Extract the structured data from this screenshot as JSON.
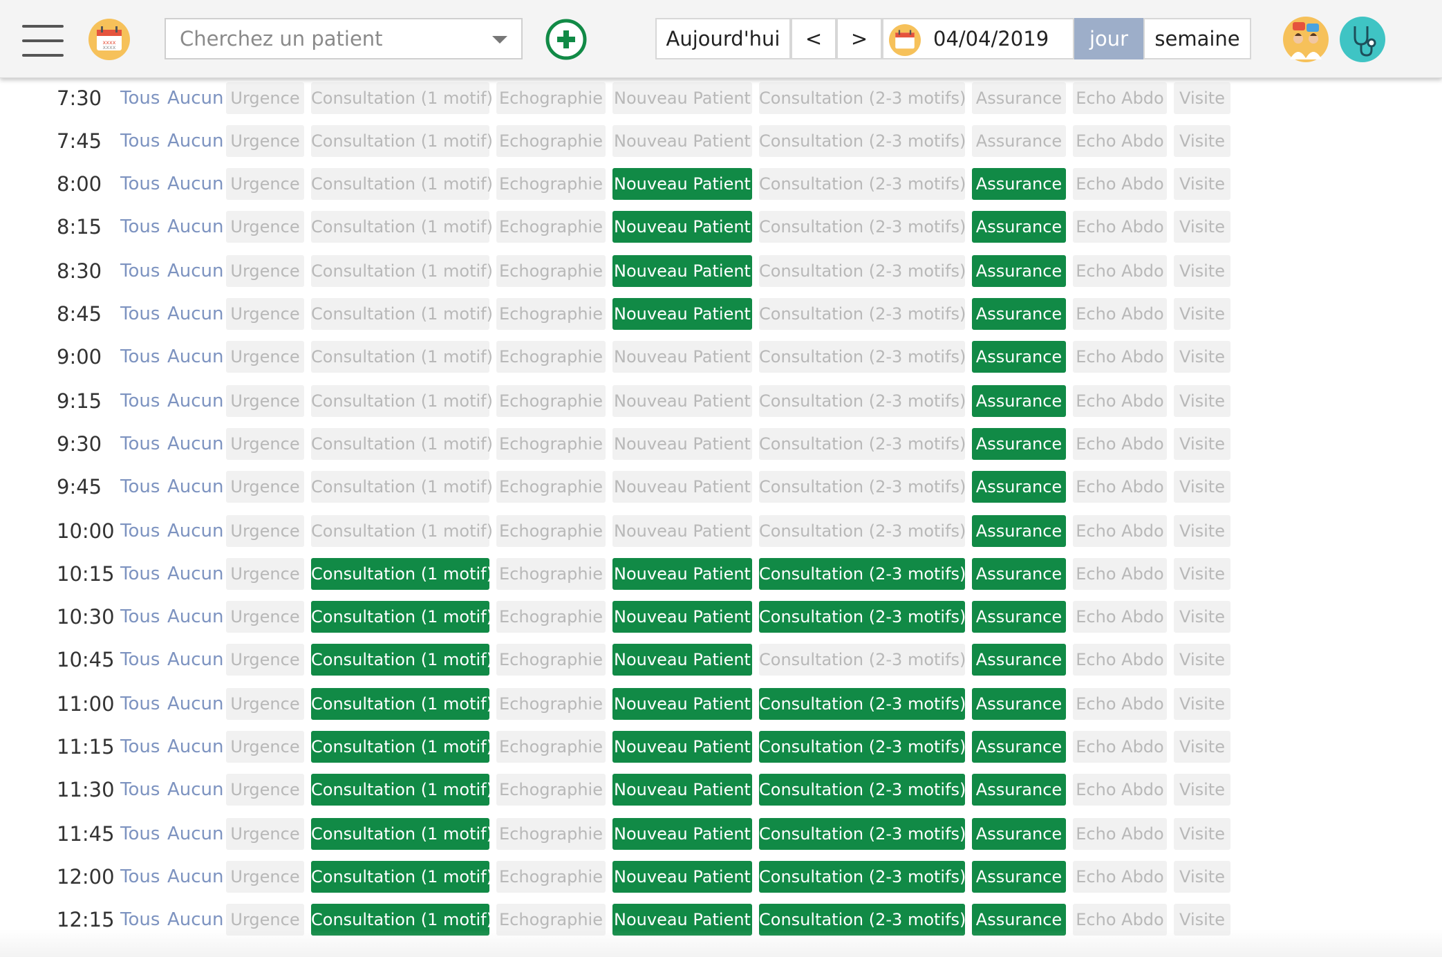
{
  "header": {
    "search_placeholder": "Cherchez un patient",
    "today_label": "Aujourd'hui",
    "prev_label": "<",
    "next_label": ">",
    "date": "04/04/2019",
    "view_day": "jour",
    "view_week": "semaine"
  },
  "colors": {
    "accent_green": "#118a46",
    "active_view": "#9daec9",
    "link_blue": "#7d93c0",
    "inactive_bg": "#f1f1f1",
    "inactive_text": "#b8b8b8"
  },
  "icons": {
    "menu": "hamburger-menu-icon",
    "calendar": "calendar-icon",
    "add": "add-circle-icon",
    "dropdown": "chevron-down-icon",
    "team": "doctors-team-icon",
    "stethoscope": "stethoscope-icon"
  },
  "row_labels": {
    "all": "Tous",
    "none": "Aucun"
  },
  "motifs": [
    "Urgence",
    "Consultation (1 motif)",
    "Echographie",
    "Nouveau Patient",
    "Consultation (2-3 motifs)",
    "Assurance",
    "Echo Abdo",
    "Visite"
  ],
  "slots": [
    {
      "time": "7:30",
      "active": [
        0,
        0,
        0,
        0,
        0,
        0,
        0,
        0
      ]
    },
    {
      "time": "7:45",
      "active": [
        0,
        0,
        0,
        0,
        0,
        0,
        0,
        0
      ]
    },
    {
      "time": "8:00",
      "active": [
        0,
        0,
        0,
        1,
        0,
        1,
        0,
        0
      ]
    },
    {
      "time": "8:15",
      "active": [
        0,
        0,
        0,
        1,
        0,
        1,
        0,
        0
      ]
    },
    {
      "time": "8:30",
      "active": [
        0,
        0,
        0,
        1,
        0,
        1,
        0,
        0
      ]
    },
    {
      "time": "8:45",
      "active": [
        0,
        0,
        0,
        1,
        0,
        1,
        0,
        0
      ]
    },
    {
      "time": "9:00",
      "active": [
        0,
        0,
        0,
        0,
        0,
        1,
        0,
        0
      ]
    },
    {
      "time": "9:15",
      "active": [
        0,
        0,
        0,
        0,
        0,
        1,
        0,
        0
      ]
    },
    {
      "time": "9:30",
      "active": [
        0,
        0,
        0,
        0,
        0,
        1,
        0,
        0
      ]
    },
    {
      "time": "9:45",
      "active": [
        0,
        0,
        0,
        0,
        0,
        1,
        0,
        0
      ]
    },
    {
      "time": "10:00",
      "active": [
        0,
        0,
        0,
        0,
        0,
        1,
        0,
        0
      ]
    },
    {
      "time": "10:15",
      "active": [
        0,
        1,
        0,
        1,
        1,
        1,
        0,
        0
      ]
    },
    {
      "time": "10:30",
      "active": [
        0,
        1,
        0,
        1,
        1,
        1,
        0,
        0
      ]
    },
    {
      "time": "10:45",
      "active": [
        0,
        1,
        0,
        1,
        0,
        1,
        0,
        0
      ]
    },
    {
      "time": "11:00",
      "active": [
        0,
        1,
        0,
        1,
        1,
        1,
        0,
        0
      ]
    },
    {
      "time": "11:15",
      "active": [
        0,
        1,
        0,
        1,
        1,
        1,
        0,
        0
      ]
    },
    {
      "time": "11:30",
      "active": [
        0,
        1,
        0,
        1,
        1,
        1,
        0,
        0
      ]
    },
    {
      "time": "11:45",
      "active": [
        0,
        1,
        0,
        1,
        1,
        1,
        0,
        0
      ]
    },
    {
      "time": "12:00",
      "active": [
        0,
        1,
        0,
        1,
        1,
        1,
        0,
        0
      ]
    },
    {
      "time": "12:15",
      "active": [
        0,
        1,
        0,
        1,
        1,
        1,
        0,
        0
      ]
    }
  ]
}
